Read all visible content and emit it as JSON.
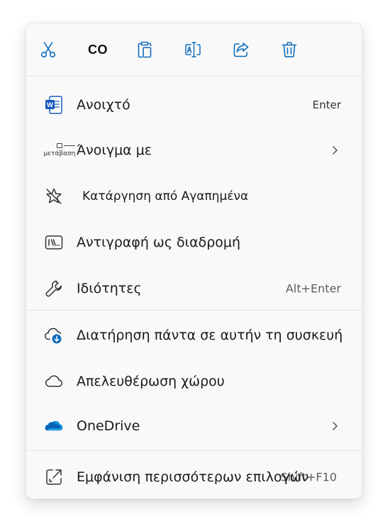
{
  "toolbar": {
    "cut_icon": "scissors-icon",
    "copy_label": "CO",
    "paste_icon": "clipboard-icon",
    "rename_icon": "rename-icon",
    "share_icon": "share-icon",
    "delete_icon": "trash-icon"
  },
  "items": [
    {
      "label": "Ανοιχτό",
      "shortcut": "Enter",
      "icon": "word-document-icon"
    },
    {
      "label": "Άνοιγμα με",
      "icon_text": "μετάβαση",
      "icon": "open-with-icon",
      "submenu": true
    },
    {
      "label": "Κατάργηση από Αγαπημένα",
      "icon": "star-remove-icon"
    },
    {
      "label": "Αντιγραφή ως διαδρομή",
      "icon": "copy-path-icon"
    },
    {
      "label": "Ιδιότητες",
      "shortcut": "Alt+Enter",
      "icon": "wrench-icon"
    },
    {
      "label": "Διατήρηση πάντα σε αυτήν τη συσκευή",
      "icon": "cloud-download-icon"
    },
    {
      "label": "Απελευθέρωση χώρου",
      "icon": "cloud-icon"
    },
    {
      "label": "OneDrive",
      "icon": "onedrive-icon",
      "submenu": true
    },
    {
      "label": "Εμφάνιση περισσότερων επιλογών",
      "shortcut": "Shift+F10",
      "icon": "show-more-icon"
    }
  ],
  "colors": {
    "accent_blue": "#0f6cbd",
    "word_blue": "#185abd",
    "onedrive_blue": "#0364b8",
    "menu_bg": "#f9f9f9"
  }
}
